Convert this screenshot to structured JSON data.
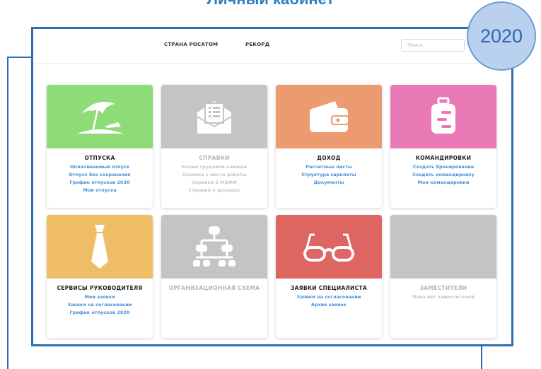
{
  "slide": {
    "title": "Личный кабинет",
    "year_badge": "2020"
  },
  "nav": {
    "links": [
      "СТРАНА РОСАТОМ",
      "РЕКОРД"
    ],
    "search_placeholder": "Поиск"
  },
  "colors": {
    "green": "#8ddc78",
    "gray": "#c4c4c4",
    "orange": "#eb9b6f",
    "pink": "#ea7ab6",
    "yellow": "#eebd66",
    "red": "#dd6562",
    "link": "#4a90d9",
    "frame": "#2d6db3"
  },
  "cards": [
    {
      "icon": "beach-umbrella-icon",
      "title": "ОТПУСКА",
      "links": [
        "Оплачиваемый отпуск",
        "Отпуск без сохранения",
        "График отпусков 2020",
        "Мои отпуска"
      ]
    },
    {
      "icon": "envelope-icon",
      "title": "СПРАВКИ",
      "links": [
        "Копия трудовой книжки",
        "Справка с места работы",
        "Справка 2-НДФЛ",
        "Справка о доходах"
      ]
    },
    {
      "icon": "wallet-icon",
      "title": "ДОХОД",
      "links": [
        "Расчетные листы",
        "Структура зарплаты",
        "Документы"
      ]
    },
    {
      "icon": "suitcase-icon",
      "title": "КОМАНДИРОВКИ",
      "links": [
        "Создать бронирование",
        "Создать командировку",
        "Мои командировки"
      ]
    },
    {
      "icon": "tie-icon",
      "title": "СЕРВИСЫ РУКОВОДИТЕЛЯ",
      "links": [
        "Мои заявки",
        "Заявки на согласовании",
        "График отпусков 2020"
      ]
    },
    {
      "icon": "org-chart-icon",
      "title": "ОРГАНИЗАЦИОННАЯ СХЕМА",
      "links": []
    },
    {
      "icon": "glasses-icon",
      "title": "ЗАЯВКИ СПЕЦИАЛИСТА",
      "links": [
        "Заявки на согласовании",
        "Архив заявок"
      ]
    },
    {
      "icon": "",
      "title": "ЗАМЕСТИТЕЛИ",
      "links": [
        "Пока нет заместителей"
      ]
    }
  ]
}
